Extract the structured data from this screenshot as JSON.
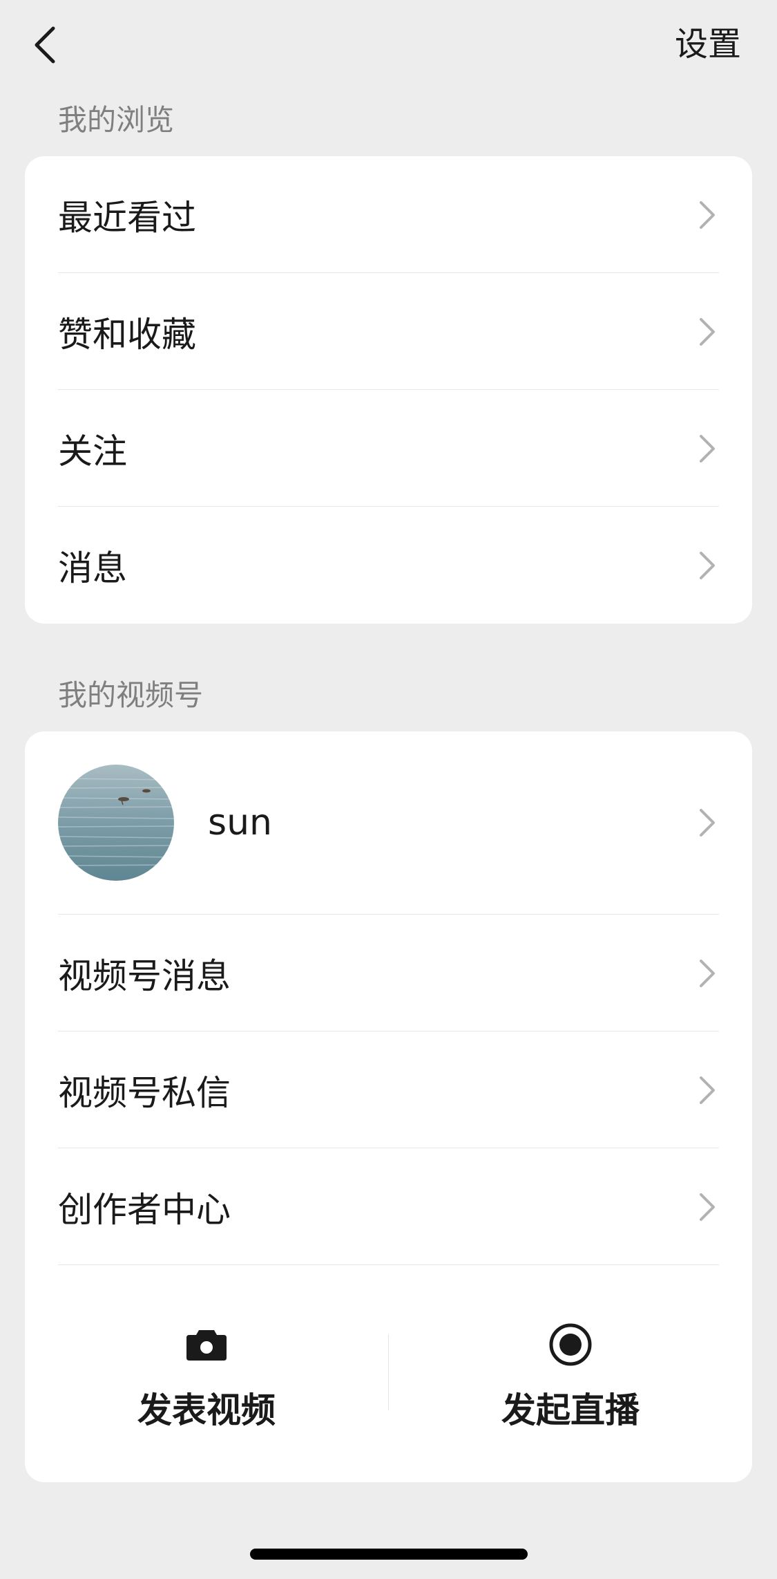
{
  "header": {
    "back_icon": "chevron-left-icon",
    "settings_label": "设置"
  },
  "browse_section": {
    "title": "我的浏览",
    "items": [
      {
        "label": "最近看过"
      },
      {
        "label": "赞和收藏"
      },
      {
        "label": "关注"
      },
      {
        "label": "消息"
      }
    ]
  },
  "channels_section": {
    "title": "我的视频号",
    "profile": {
      "name": "sun",
      "avatar": "sea-birds-photo"
    },
    "items": [
      {
        "label": "视频号消息"
      },
      {
        "label": "视频号私信"
      },
      {
        "label": "创作者中心"
      }
    ],
    "actions": [
      {
        "label": "发表视频",
        "icon": "camera-icon"
      },
      {
        "label": "发起直播",
        "icon": "live-record-icon"
      }
    ]
  },
  "colors": {
    "background": "#ededed",
    "card": "#ffffff",
    "section_title": "#7f7f7f",
    "chevron": "#b2b2b2"
  }
}
